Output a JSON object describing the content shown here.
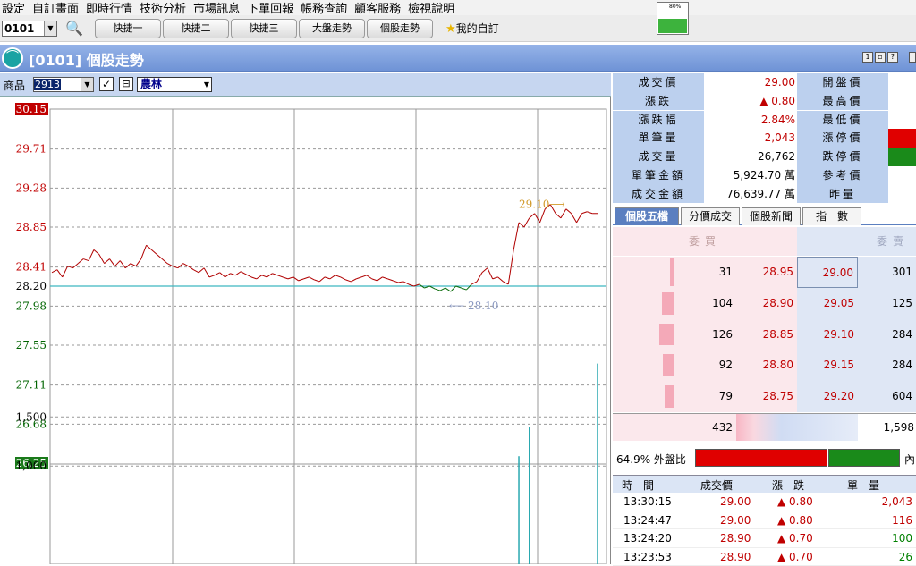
{
  "menu": [
    "設定",
    "自訂畫面",
    "即時行情",
    "技術分析",
    "市場訊息",
    "下單回報",
    "帳務查詢",
    "顧客服務",
    "檢視說明"
  ],
  "toolbar": {
    "code": "0101",
    "quick_buttons": [
      "快捷一",
      "快捷二",
      "快捷三",
      "大盤走勢",
      "個股走勢"
    ],
    "favorites": "我的自訂",
    "meter_label": "80%",
    "meter_level": 0.6
  },
  "window": {
    "title": "[0101] 個股走勢",
    "btn1": "1",
    "btn2": "▫",
    "btn3": "?"
  },
  "product": {
    "label": "商品",
    "code": "2913",
    "name": "農林",
    "chk1": "✓",
    "chk2": "⊟"
  },
  "chart": {
    "price_ticks": [
      {
        "v": 30.15,
        "label": "30.15",
        "style": "box-red"
      },
      {
        "v": 29.71,
        "label": "29.71",
        "style": "red"
      },
      {
        "v": 29.28,
        "label": "29.28",
        "style": "red"
      },
      {
        "v": 28.85,
        "label": "28.85",
        "style": "red"
      },
      {
        "v": 28.41,
        "label": "28.41",
        "style": "red"
      },
      {
        "v": 28.2,
        "label": "28.20",
        "style": "black"
      },
      {
        "v": 27.98,
        "label": "27.98",
        "style": "green"
      },
      {
        "v": 27.55,
        "label": "27.55",
        "style": "green"
      },
      {
        "v": 27.11,
        "label": "27.11",
        "style": "green"
      },
      {
        "v": 26.68,
        "label": "26.68",
        "style": "green"
      },
      {
        "v": 26.25,
        "label": "26.25",
        "style": "box-green"
      }
    ],
    "volume_ticks": [
      {
        "v": 1500,
        "label": "1,500"
      },
      {
        "v": 1000,
        "label": "1,000"
      }
    ],
    "ref_price": 28.2,
    "high_annotation": "29.10⟶",
    "low_annotation": "⟵ 28.10",
    "series": [
      28.35,
      28.38,
      28.3,
      28.42,
      28.4,
      28.45,
      28.5,
      28.48,
      28.6,
      28.55,
      28.45,
      28.5,
      28.42,
      28.48,
      28.4,
      28.45,
      28.42,
      28.5,
      28.65,
      28.6,
      28.55,
      28.5,
      28.45,
      28.42,
      28.4,
      28.45,
      28.42,
      28.38,
      28.35,
      28.4,
      28.3,
      28.32,
      28.35,
      28.3,
      28.34,
      28.32,
      28.36,
      28.33,
      28.3,
      28.28,
      28.32,
      28.3,
      28.34,
      28.32,
      28.3,
      28.28,
      28.3,
      28.26,
      28.28,
      28.3,
      28.27,
      28.25,
      28.3,
      28.28,
      28.32,
      28.3,
      28.27,
      28.25,
      28.28,
      28.3,
      28.32,
      28.28,
      28.26,
      28.3,
      28.28,
      28.26,
      28.24,
      28.25,
      28.22,
      28.2,
      28.22,
      28.18,
      28.2,
      28.17,
      28.15,
      28.18,
      28.14,
      28.2,
      28.18,
      28.16,
      28.22,
      28.25,
      28.35,
      28.4,
      28.28,
      28.3,
      28.25,
      28.22,
      28.6,
      28.9,
      28.85,
      28.95,
      29.0,
      28.9,
      29.05,
      29.1,
      29.0,
      28.95,
      29.05,
      29.0,
      28.9,
      29.0,
      29.02,
      29.0,
      29.0
    ],
    "volumes": [
      0,
      0,
      0,
      0,
      0,
      0,
      0,
      0,
      0,
      0,
      0,
      0,
      0,
      0,
      0,
      0,
      0,
      0,
      0,
      0,
      0,
      0,
      0,
      0,
      0,
      0,
      0,
      0,
      0,
      0,
      0,
      0,
      0,
      0,
      0,
      0,
      0,
      0,
      0,
      0,
      0,
      0,
      0,
      0,
      0,
      0,
      0,
      0,
      0,
      0,
      0,
      0,
      0,
      0,
      0,
      0,
      0,
      0,
      0,
      0,
      0,
      0,
      0,
      0,
      0,
      0,
      0,
      0,
      0,
      0,
      0,
      0,
      0,
      0,
      0,
      0,
      0,
      0,
      0,
      0,
      0,
      0,
      0,
      0,
      0,
      0,
      0,
      0,
      0,
      1100,
      0,
      1400,
      0,
      0,
      0,
      0,
      0,
      0,
      0,
      0,
      0,
      0,
      0,
      0,
      2043
    ]
  },
  "quote": {
    "rows": [
      {
        "l1": "成交價",
        "v1": "29.00",
        "c1": "red",
        "l2": "開盤價",
        "v2color": ""
      },
      {
        "l1": "漲跌",
        "v1": "▲ 0.80",
        "c1": "red",
        "l2": "最高價",
        "v2color": ""
      },
      {
        "l1": "漲跌幅",
        "v1": "2.84%",
        "c1": "red",
        "l2": "最低價",
        "v2color": ""
      },
      {
        "l1": "單筆量",
        "v1": "2,043",
        "c1": "red",
        "l2": "漲停價",
        "v2color": "#e00000"
      },
      {
        "l1": "成交量",
        "v1": "26,762",
        "c1": "black",
        "l2": "跌停價",
        "v2color": "#1a8a1a"
      },
      {
        "l1": "單筆金額",
        "v1": "5,924.70 萬",
        "c1": "black",
        "l2": "參考價",
        "v2color": ""
      },
      {
        "l1": "成交金額",
        "v1": "76,639.77 萬",
        "c1": "black",
        "l2": "昨量",
        "v2color": ""
      }
    ]
  },
  "tabs": [
    "個股五檔",
    "分價成交",
    "個股新聞",
    "指　數"
  ],
  "five": {
    "buy_header": "委買",
    "sell_header": "委賣",
    "rows": [
      {
        "bidvol": "31",
        "bid": "28.95",
        "ask": "29.00",
        "askvol": "301",
        "bar": 0.07
      },
      {
        "bidvol": "104",
        "bid": "28.90",
        "ask": "29.05",
        "askvol": "125",
        "bar": 0.24
      },
      {
        "bidvol": "126",
        "bid": "28.85",
        "ask": "29.10",
        "askvol": "284",
        "bar": 0.29
      },
      {
        "bidvol": "92",
        "bid": "28.80",
        "ask": "29.15",
        "askvol": "284",
        "bar": 0.21
      },
      {
        "bidvol": "79",
        "bid": "28.75",
        "ask": "29.20",
        "askvol": "604",
        "bar": 0.18
      }
    ],
    "bid_total": "432",
    "ask_total": "1,598"
  },
  "ratio": {
    "text": "64.9% 外盤比",
    "in_label": "內"
  },
  "ticks": {
    "headers": [
      "時　間",
      "成交價",
      "漲　跌",
      "單　量"
    ],
    "rows": [
      {
        "time": "13:30:15",
        "price": "29.00",
        "chg": "▲  0.80",
        "vol": "2,043",
        "vc": "red"
      },
      {
        "time": "13:24:47",
        "price": "29.00",
        "chg": "▲  0.80",
        "vol": "116",
        "vc": "red"
      },
      {
        "time": "13:24:20",
        "price": "28.90",
        "chg": "▲  0.70",
        "vol": "100",
        "vc": "green"
      },
      {
        "time": "13:23:53",
        "price": "28.90",
        "chg": "▲  0.70",
        "vol": "26",
        "vc": "green"
      }
    ]
  }
}
